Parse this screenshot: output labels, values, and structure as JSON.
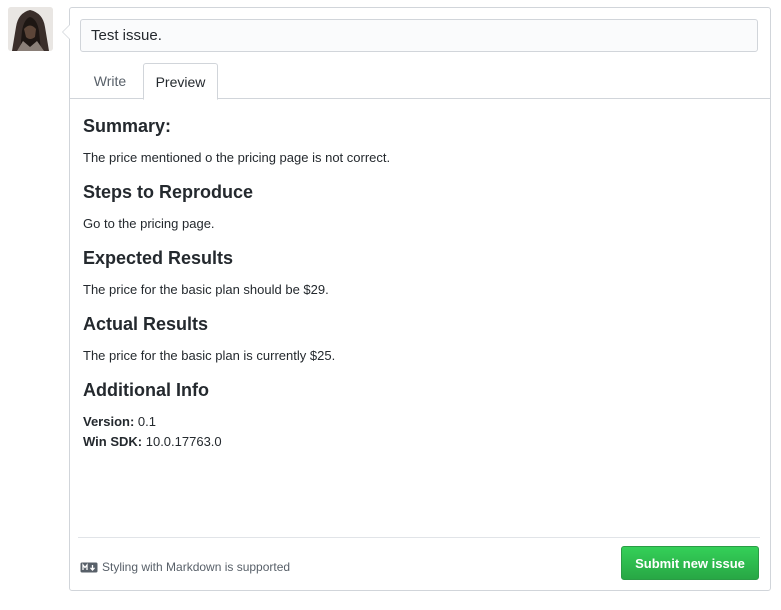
{
  "issue": {
    "title_value": "Test issue."
  },
  "tabs": [
    {
      "label": "Write"
    },
    {
      "label": "Preview"
    }
  ],
  "preview": {
    "summary_heading": "Summary:",
    "summary_text": "The price mentioned o the pricing page is not correct.",
    "steps_heading": "Steps to Reproduce",
    "steps_text": "Go to the pricing page.",
    "expected_heading": "Expected Results",
    "expected_text": "The price for the basic plan should be $29.",
    "actual_heading": "Actual Results",
    "actual_text": "The price for the basic plan is currently $25.",
    "additional_heading": "Additional Info",
    "version_label": "Version:",
    "version_value": "0.1",
    "sdk_label": "Win SDK:",
    "sdk_value": "10.0.17763.0"
  },
  "footer": {
    "markdown_note": "Styling with Markdown is supported",
    "submit_label": "Submit new issue"
  },
  "icons": {
    "markdown": "markdown-icon",
    "avatar": "user-avatar"
  },
  "colors": {
    "submit_green": "#2ea44f",
    "border": "#d1d5da"
  }
}
